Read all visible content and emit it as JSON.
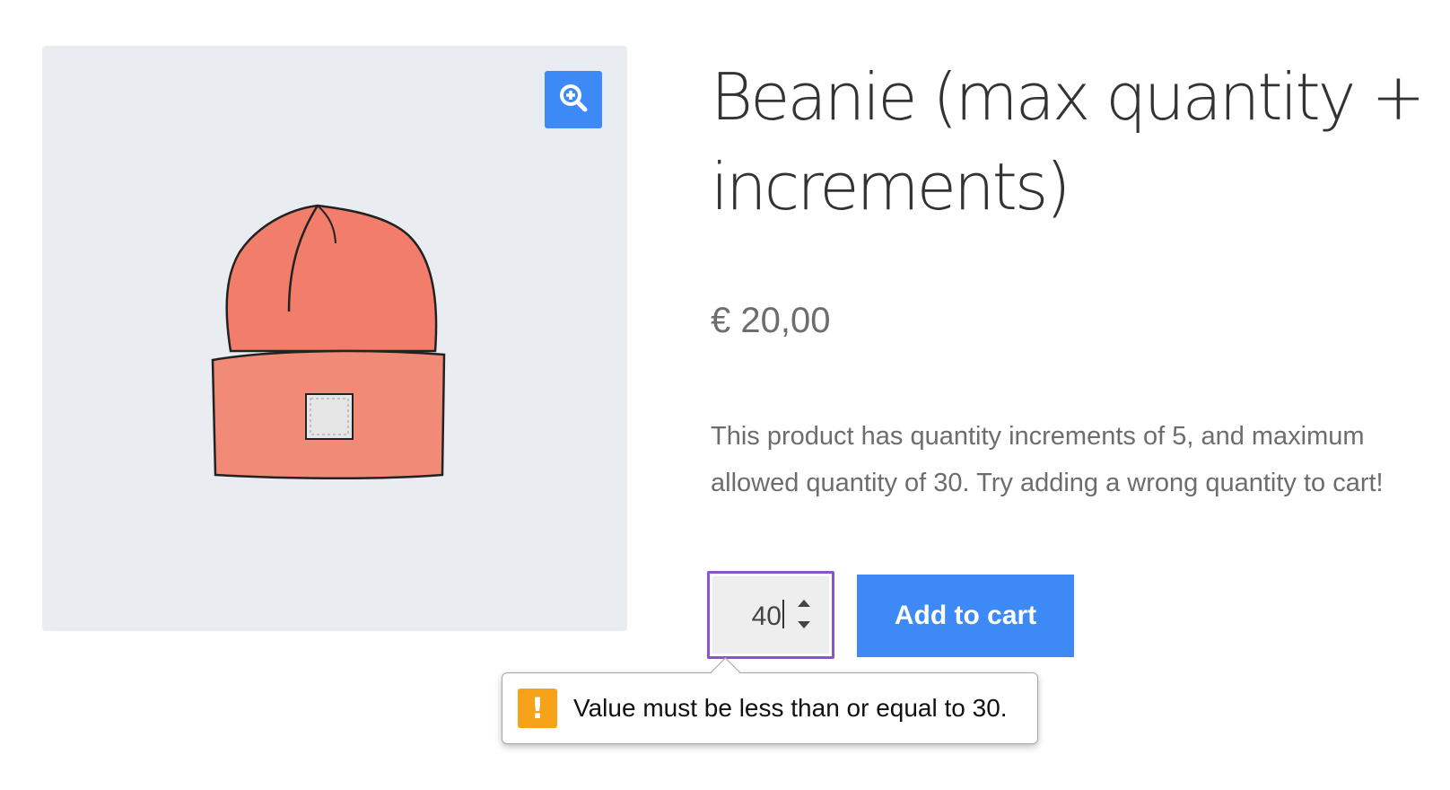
{
  "product": {
    "title": "Beanie (max quantity + increments)",
    "price": "€ 20,00",
    "description": "This product has quantity increments of 5, and maximum allowed quantity of 30. Try adding a wrong quantity to cart!",
    "image_icon": "beanie-hat-illustration"
  },
  "gallery": {
    "zoom_icon": "magnifier-plus-icon"
  },
  "cart_form": {
    "quantity_value": "40",
    "add_to_cart_label": "Add to cart"
  },
  "validation": {
    "message": "Value must be less than or equal to 30.",
    "icon": "exclamation-warning-icon",
    "icon_glyph": "!"
  },
  "colors": {
    "accent": "#3d8af7",
    "focus_ring": "#8b55c9",
    "warning": "#f6a11a",
    "gallery_bg": "#e9edf2"
  }
}
